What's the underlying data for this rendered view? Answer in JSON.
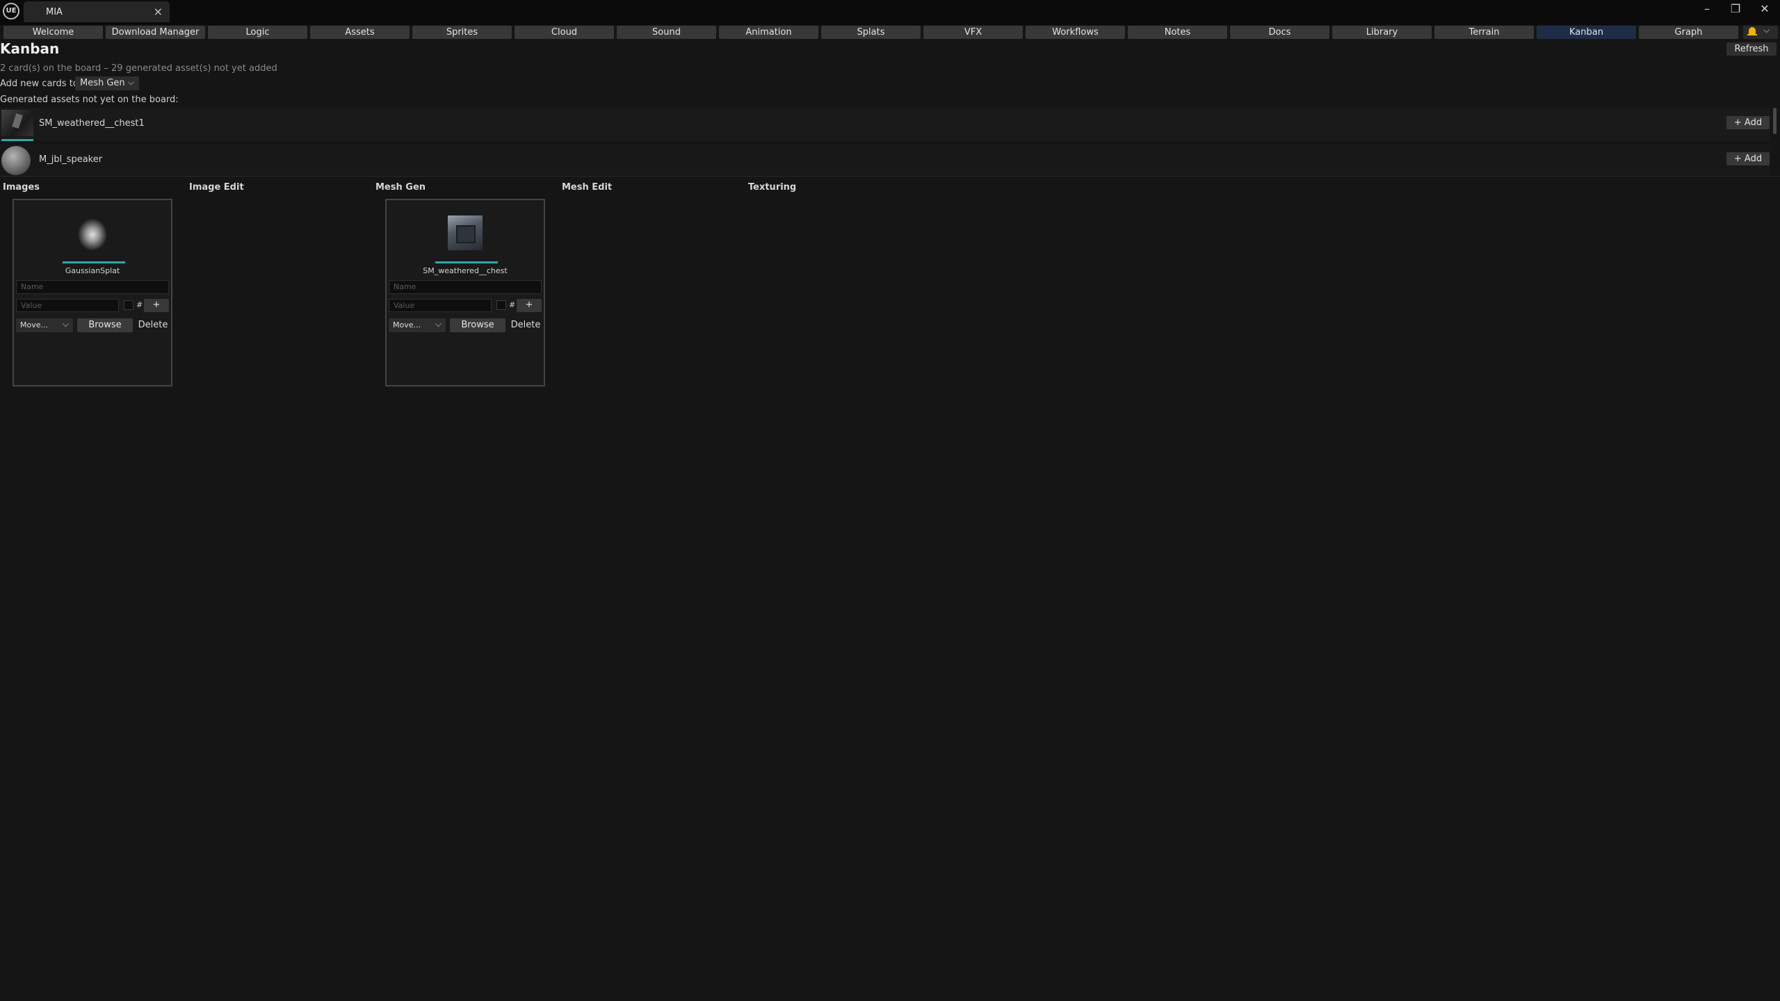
{
  "window": {
    "logo": "UE",
    "tab_title": "MIA",
    "tab_close": "×",
    "controls": {
      "minimize": "–",
      "restore": "❐",
      "close": "✕"
    }
  },
  "tabs": [
    "Welcome",
    "Download Manager",
    "Logic",
    "Assets",
    "Sprites",
    "Cloud",
    "Sound",
    "Animation",
    "Splats",
    "VFX",
    "Workflows",
    "Notes",
    "Docs",
    "Library",
    "Terrain",
    "Kanban",
    "Graph"
  ],
  "active_tab": "Kanban",
  "page": {
    "title": "Kanban",
    "refresh_label": "Refresh",
    "summary": "2 card(s) on the board – 29 generated asset(s) not yet added",
    "add_to_label": "Add new cards to:",
    "add_to_value": "Mesh Gen",
    "generated_label": "Generated assets not yet on the board:"
  },
  "assets": [
    {
      "name": "SM_weathered__chest1",
      "add_label": "+ Add"
    },
    {
      "name": "M_jbl_speaker",
      "add_label": "+ Add"
    }
  ],
  "columns": [
    "Images",
    "Image Edit",
    "Mesh Gen",
    "Mesh Edit",
    "Texturing"
  ],
  "cards": [
    {
      "column": "Images",
      "name": "GaussianSplat",
      "name_placeholder": "Name",
      "value_placeholder": "Value",
      "hash": "#",
      "plus": "+",
      "move_label": "Move...",
      "browse_label": "Browse",
      "delete_label": "Delete"
    },
    {
      "column": "Mesh Gen",
      "name": "SM_weathered__chest",
      "name_placeholder": "Name",
      "value_placeholder": "Value",
      "hash": "#",
      "plus": "+",
      "move_label": "Move...",
      "browse_label": "Browse",
      "delete_label": "Delete"
    }
  ],
  "colors": {
    "active_tab": "#1d2d47",
    "accent": "#2fa7ad",
    "notification": "#f0b400"
  }
}
